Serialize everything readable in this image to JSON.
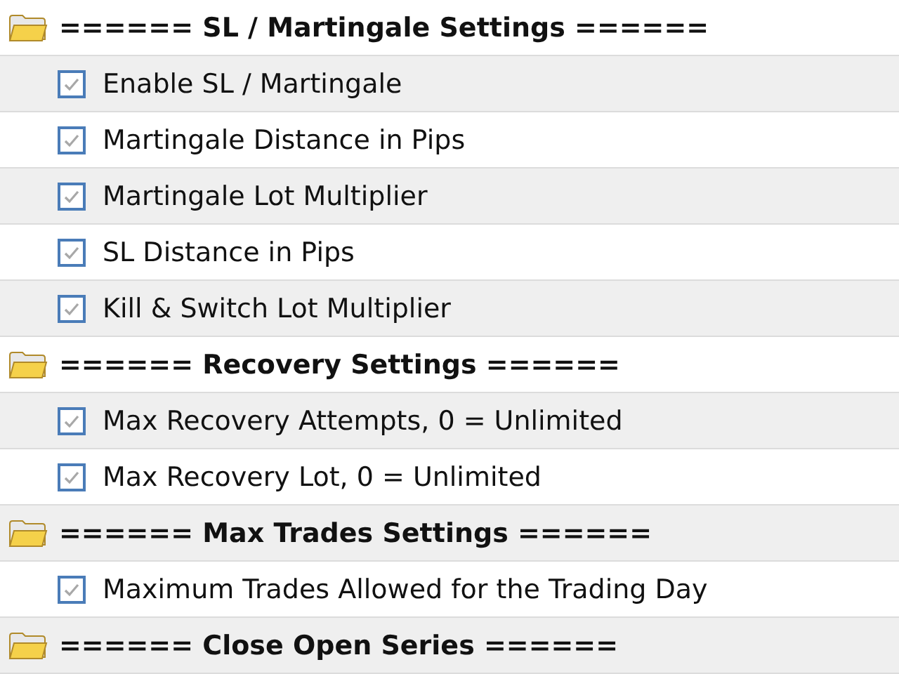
{
  "groups": [
    {
      "title": "====== SL / Martingale Settings ======",
      "expanded": true,
      "items": [
        {
          "label": "Enable SL / Martingale",
          "checked": true
        },
        {
          "label": "Martingale Distance in Pips",
          "checked": true
        },
        {
          "label": "Martingale Lot Multiplier",
          "checked": true
        },
        {
          "label": "SL Distance in Pips",
          "checked": true
        },
        {
          "label": "Kill & Switch Lot Multiplier",
          "checked": true
        }
      ]
    },
    {
      "title": "====== Recovery Settings ======",
      "expanded": true,
      "items": [
        {
          "label": "Max Recovery Attempts, 0 = Unlimited",
          "checked": true
        },
        {
          "label": "Max Recovery Lot, 0 = Unlimited",
          "checked": true
        }
      ]
    },
    {
      "title": "====== Max Trades Settings ======",
      "expanded": true,
      "items": [
        {
          "label": "Maximum Trades Allowed for the Trading Day",
          "checked": true
        }
      ]
    },
    {
      "title": "====== Close Open Series ======",
      "expanded": true
    }
  ]
}
